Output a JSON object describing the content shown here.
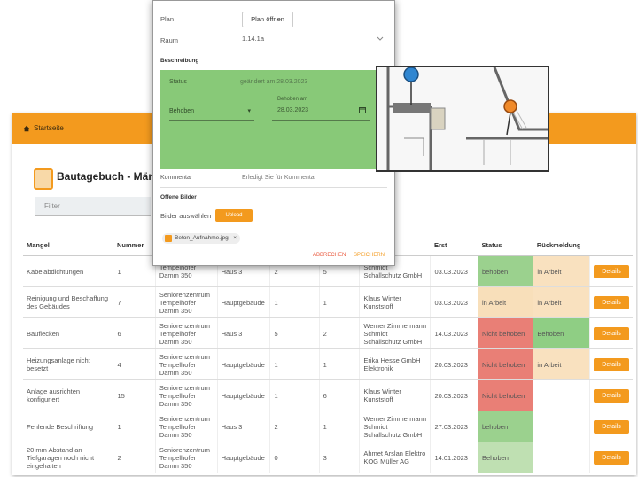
{
  "topbar": {
    "crumb": "Startseite"
  },
  "app": {
    "title": "Bautagebuch - Mänge"
  },
  "filter": {
    "placeholder": "Filter"
  },
  "table": {
    "headers": [
      "Mangel",
      "Nummer",
      "",
      "",
      "",
      "",
      "",
      "Erst",
      "Status",
      "Rückmeldung",
      ""
    ],
    "rows": [
      {
        "mangel": "Kabelabdichtungen",
        "nummer": "1",
        "ort": "Tempelhofer Damm 350",
        "gebaeude": "Haus 3",
        "c1": "2",
        "c2": "5",
        "firma": "Schmidt Schallschutz GmbH",
        "datum": "03.03.2023",
        "status": "behoben",
        "status_class": "s-green",
        "rm": "in Arbeit",
        "rm_class": "rm-beige",
        "btn": "Details"
      },
      {
        "mangel": "Reinigung und Beschaffung des Gebäudes",
        "nummer": "7",
        "ort": "Seniorenzentrum Tempelhofer Damm 350",
        "gebaeude": "Hauptgebäude",
        "c1": "1",
        "c2": "1",
        "firma": "Klaus Winter Kunststoff",
        "datum": "03.03.2023",
        "status": "in Arbeit",
        "status_class": "s-beige",
        "rm": "in Arbeit",
        "rm_class": "rm-beige",
        "btn": "Details"
      },
      {
        "mangel": "Bauflecken",
        "nummer": "6",
        "ort": "Seniorenzentrum Tempelhofer Damm 350",
        "gebaeude": "Haus 3",
        "c1": "5",
        "c2": "2",
        "firma": "Werner Zimmermann Schmidt Schallschutz GmbH",
        "datum": "14.03.2023",
        "status": "Nicht behoben",
        "status_class": "s-red",
        "rm": "Behoben",
        "rm_class": "rm-green",
        "btn": "Details"
      },
      {
        "mangel": "Heizungsanlage nicht besetzt",
        "nummer": "4",
        "ort": "Seniorenzentrum Tempelhofer Damm 350",
        "gebaeude": "Hauptgebäude",
        "c1": "1",
        "c2": "1",
        "firma": "Erika Hesse GmbH Elektronik",
        "datum": "20.03.2023",
        "status": "Nicht behoben",
        "status_class": "s-red",
        "rm": "in Arbeit",
        "rm_class": "rm-beige",
        "btn": "Details"
      },
      {
        "mangel": "Anlage ausrichten konfiguriert",
        "nummer": "15",
        "ort": "Seniorenzentrum Tempelhofer Damm 350",
        "gebaeude": "Hauptgebäude",
        "c1": "1",
        "c2": "6",
        "firma": "Klaus Winter Kunststoff",
        "datum": "20.03.2023",
        "status": "Nicht behoben",
        "status_class": "s-red",
        "rm": "",
        "rm_class": "",
        "btn": "Details"
      },
      {
        "mangel": "Fehlende Beschriftung",
        "nummer": "1",
        "ort": "Seniorenzentrum Tempelhofer Damm 350",
        "gebaeude": "Haus 3",
        "c1": "2",
        "c2": "1",
        "firma": "Werner Zimmermann Schmidt Schallschutz GmbH",
        "datum": "27.03.2023",
        "status": "behoben",
        "status_class": "s-green",
        "rm": "",
        "rm_class": "",
        "btn": "Details"
      },
      {
        "mangel": "20 mm Abstand an Tiefgaragen noch nicht eingehalten",
        "nummer": "2",
        "ort": "Seniorenzentrum Tempelhofer Damm 350",
        "gebaeude": "Hauptgebäude",
        "c1": "0",
        "c2": "3",
        "firma": "Ahmet Arslan Elektro KOG Müller AG",
        "datum": "14.01.2023",
        "status": "Behoben",
        "status_class": "s-lgreen",
        "rm": "",
        "rm_class": "",
        "btn": "Details"
      }
    ]
  },
  "dialog": {
    "plan_label": "Plan",
    "plan_button": "Plan öffnen",
    "bauteil_label": "Raum",
    "bauteil_value": "1.14.1a",
    "section_beschreibung": "Beschreibung",
    "status_label": "Status",
    "status_meta": "geändert am 28.03.2023",
    "status_value": "Behoben",
    "date_label": "Behoben am",
    "date_value": "28.03.2023",
    "kommentar_label": "Kommentar",
    "kommentar_value": "Erledigt Sie für Kommentar",
    "section_bilder": "Offene Bilder",
    "bilder_label": "Bilder auswählen",
    "upload_label": "Upload",
    "file_name": "Beton_Aufnahme.jpg",
    "abbrechen": "ABBRECHEN",
    "speichern": "SPEICHERN"
  },
  "colors": {
    "accent": "#f39a1e",
    "ok": "#88c978",
    "bad": "#e97f76",
    "pending": "#f8dfba"
  }
}
